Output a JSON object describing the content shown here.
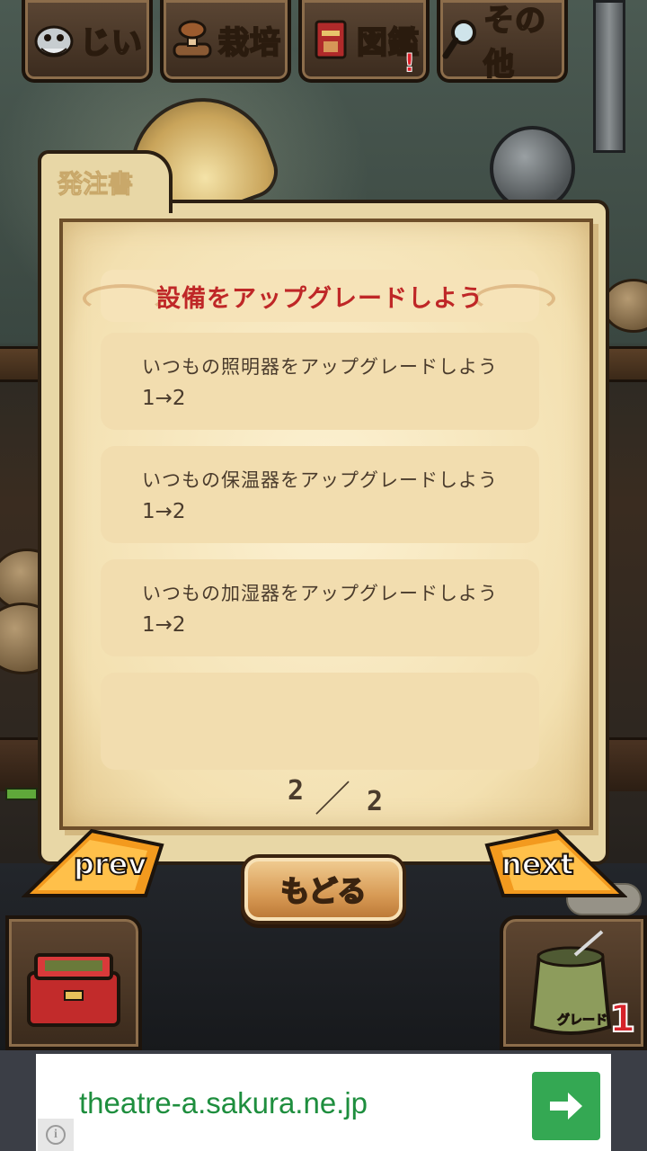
{
  "nav": {
    "tabs": [
      {
        "label": "じい",
        "icon": "grandpa-icon"
      },
      {
        "label": "栽培",
        "icon": "mushroom-log-icon"
      },
      {
        "label": "図鑑",
        "icon": "book-icon",
        "alert": "!"
      },
      {
        "label": "その他",
        "icon": "magnifier-icon"
      }
    ]
  },
  "order_book": {
    "tab_label": "発注書",
    "headline": "設備をアップグレードしよう",
    "tasks": [
      {
        "title": "いつもの照明器をアップグレードしよう",
        "level": "1→2"
      },
      {
        "title": "いつもの保温器をアップグレードしよう",
        "level": "1→2"
      },
      {
        "title": "いつもの加湿器をアップグレードしよう",
        "level": "1→2"
      },
      {
        "title": "",
        "level": ""
      }
    ],
    "page_current": "2",
    "page_separator": "／",
    "page_total": "2"
  },
  "controls": {
    "prev_label": "prev",
    "next_label": "next",
    "back_label": "もどる"
  },
  "grade": {
    "label": "グレード",
    "value": "1"
  },
  "ad": {
    "url_text": "theatre-a.sakura.ne.jp",
    "button_icon": "arrow-right-icon",
    "info_icon": "info-icon",
    "info_glyph": "i"
  },
  "colors": {
    "headline": "#bf2727",
    "ad_text": "#1e8e3e",
    "ad_button": "#34a853",
    "grade_number": "#d6222a"
  }
}
